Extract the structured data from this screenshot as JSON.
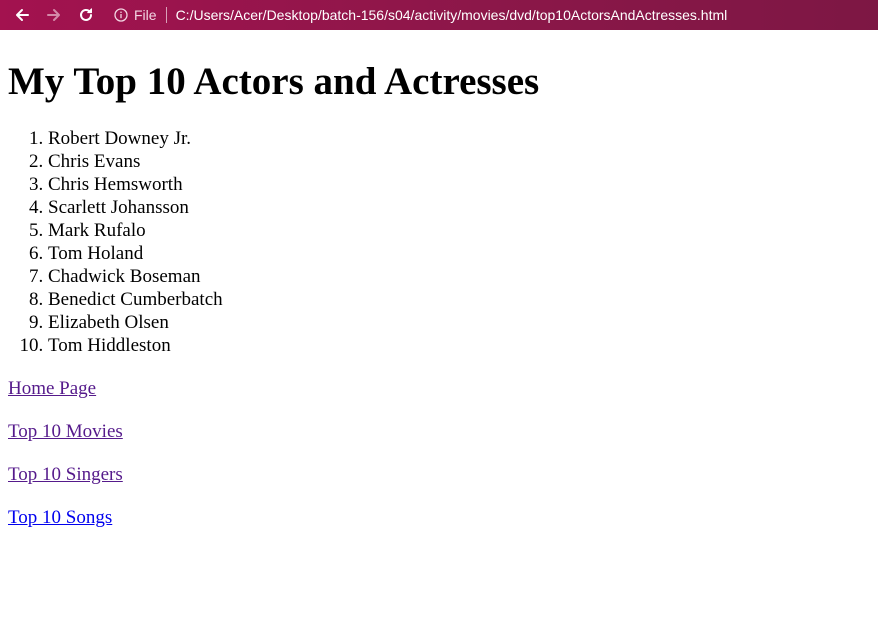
{
  "browser": {
    "scheme_label": "File",
    "url": "C:/Users/Acer/Desktop/batch-156/s04/activity/movies/dvd/top10ActorsAndActresses.html",
    "accent_color": "#a3124f"
  },
  "page": {
    "title": "My Top 10 Actors and Actresses",
    "actors": [
      "Robert Downey Jr.",
      "Chris Evans",
      "Chris Hemsworth",
      "Scarlett Johansson",
      "Mark Rufalo",
      "Tom Holand",
      "Chadwick Boseman",
      "Benedict Cumberbatch",
      "Elizabeth Olsen",
      "Tom Hiddleston"
    ],
    "links": [
      {
        "label": "Home Page",
        "visited": true
      },
      {
        "label": "Top 10 Movies",
        "visited": true
      },
      {
        "label": "Top 10 Singers",
        "visited": true
      },
      {
        "label": "Top 10 Songs",
        "visited": false
      }
    ]
  },
  "colors": {
    "visited_link": "#551a8b",
    "unvisited_link": "#0000ee"
  },
  "icons": {
    "back": "arrow-left-icon",
    "forward": "arrow-right-icon",
    "reload": "reload-icon",
    "info": "info-icon"
  }
}
